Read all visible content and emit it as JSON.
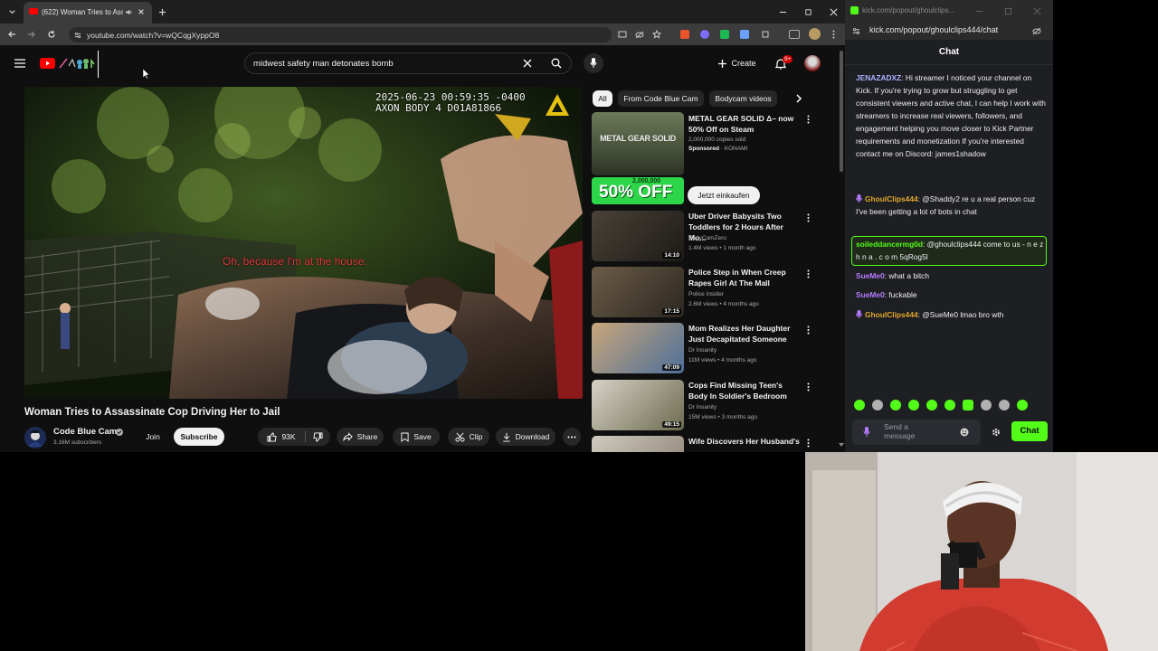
{
  "browser": {
    "tab_title": "(622) Woman Tries to Assa...",
    "url": "youtube.com/watch?v=wQCqgXyppO8"
  },
  "youtube": {
    "search_query": "midwest safety man detonates bomb",
    "create_label": "Create",
    "notification_count": "9+",
    "video": {
      "timestamp_overlay_line1": "2025-06-23 00:59:35 -0400",
      "timestamp_overlay_line2": "AXON BODY 4 D01A81866",
      "subtitle": "Oh, because I'm at the house.",
      "title": "Woman Tries to Assassinate Cop Driving Her to Jail"
    },
    "channel": {
      "name": "Code Blue Cam",
      "subscribers": "3.16M subscribers",
      "join_label": "Join",
      "subscribe_label": "Subscribe"
    },
    "actions": {
      "likes": "93K",
      "share": "Share",
      "save": "Save",
      "clip": "Clip",
      "download": "Download"
    },
    "filter_chips": [
      "All",
      "From Code Blue Cam",
      "Bodycam videos"
    ],
    "ad": {
      "title": "METAL GEAR SOLID Δ– now 50% Off on Steam",
      "subtitle": "2,000,000 copies sold",
      "sponsor_label": "Sponsored",
      "sponsor_name": "KONAMI",
      "cta": "Jetzt einkaufen",
      "banner_count": "2,000,000",
      "banner_discount": "50% OFF",
      "thumb_text": "METAL GEAR SOLID"
    },
    "recommendations": [
      {
        "title": "Uber Driver Babysits Two Toddlers for 2 Hours After Mo...",
        "channel": "BodyCamZero",
        "meta": "1.4M views • 1 month ago",
        "duration": "14:10"
      },
      {
        "title": "Police Step in When Creep Rapes Girl At The Mall",
        "channel": "Police Insider",
        "meta": "2.6M views • 4 months ago",
        "duration": "17:15"
      },
      {
        "title": "Mom Realizes Her Daughter Just Decapitated Someone",
        "channel": "Dr Insanity",
        "meta": "11M views • 4 months ago",
        "duration": "47:09"
      },
      {
        "title": "Cops Find Missing Teen's Body In Soldier's Bedroom",
        "channel": "Dr Insanity",
        "meta": "15M views • 3 months ago",
        "duration": "49:15"
      },
      {
        "title": "Wife Discovers Her Husband's",
        "channel": "",
        "meta": "",
        "duration": ""
      }
    ]
  },
  "chat": {
    "titlebar_url": "kick.com/popout/ghoulclips...",
    "url": "kick.com/popout/ghoulclips444/chat",
    "header": "Chat",
    "messages": [
      {
        "user": "JENAZADXZ",
        "text": "Hi streamer I noticed your channel on Kick. If you're trying to grow but struggling to get consistent viewers and active chat, I can help I work with streamers to increase real viewers, followers, and engagement helping you move closer to Kick Partner requirements and monetization If you're interested contact me on Discord: james1shadow",
        "color": "#a8b4ff"
      },
      {
        "user": "GhoulClips444",
        "text": "@Shaddy2 re u a real person cuz I've been getting a lot of bots in chat",
        "color": "#e1a72e"
      },
      {
        "user": "soileddancermg0d",
        "text": "@ghoulclips444 come to us - n e z h n a . c o m 5qRog5l",
        "color": "#53fc18"
      },
      {
        "user": "SueMe0",
        "text": "what a bitch",
        "color": "#b57cff"
      },
      {
        "user": "SueMe0",
        "text": "fuckable",
        "color": "#b57cff"
      },
      {
        "user": "GhoulClips444",
        "text": "@SueMe0 lmao bro wth",
        "color": "#e1a72e"
      }
    ],
    "input_placeholder": "Send a message",
    "send_label": "Chat",
    "accent": "#53fc18"
  }
}
